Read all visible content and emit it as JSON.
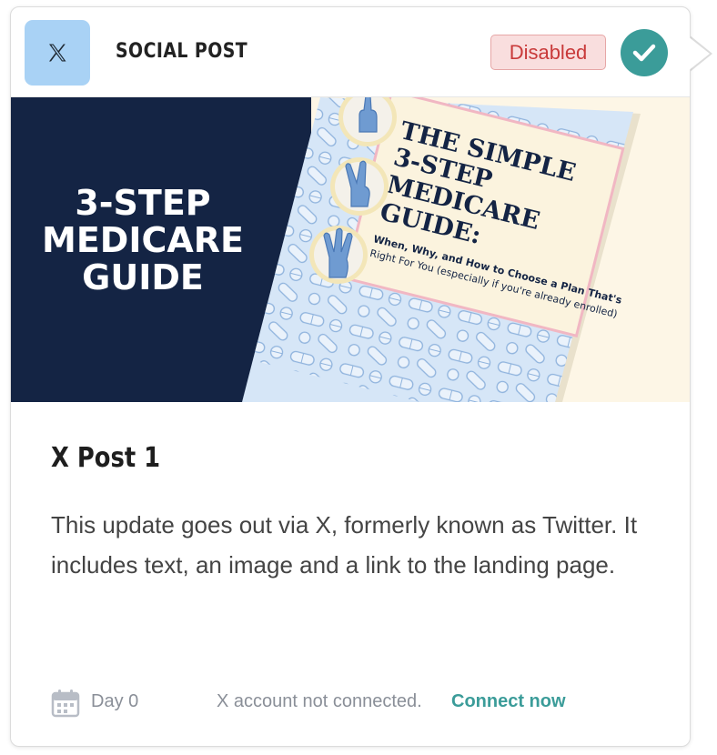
{
  "header": {
    "icon": "x-logo-icon",
    "card_type": "SOCIAL POST",
    "status": "Disabled",
    "status_colors": {
      "bg": "#f9dede",
      "border": "#e6a6a6",
      "text": "#c93a3a"
    },
    "check_icon": "check-icon",
    "accent": "#3b9c99",
    "logo_bg": "#a9d2f5"
  },
  "banner": {
    "headline": [
      "3-STEP",
      "MEDICARE",
      "GUIDE"
    ],
    "book": {
      "title": [
        "THE SIMPLE",
        "3-STEP",
        "MEDICARE",
        "GUIDE:"
      ],
      "subtitle": [
        "When, Why, and How to Choose a Plan That's",
        "Right For You (especially if you're already enrolled)"
      ]
    },
    "colors": {
      "navy": "#142444",
      "cream": "#fdf6e6",
      "pill_bg": "#d6e6f7"
    }
  },
  "post": {
    "title": "X Post 1",
    "description": "This update goes out via X, formerly known as Twitter. It includes text, an image and a link to the landing page."
  },
  "footer": {
    "calendar_icon": "calendar-icon",
    "day": "Day 0",
    "status_text": "X account not connected.",
    "connect_label": "Connect now"
  }
}
